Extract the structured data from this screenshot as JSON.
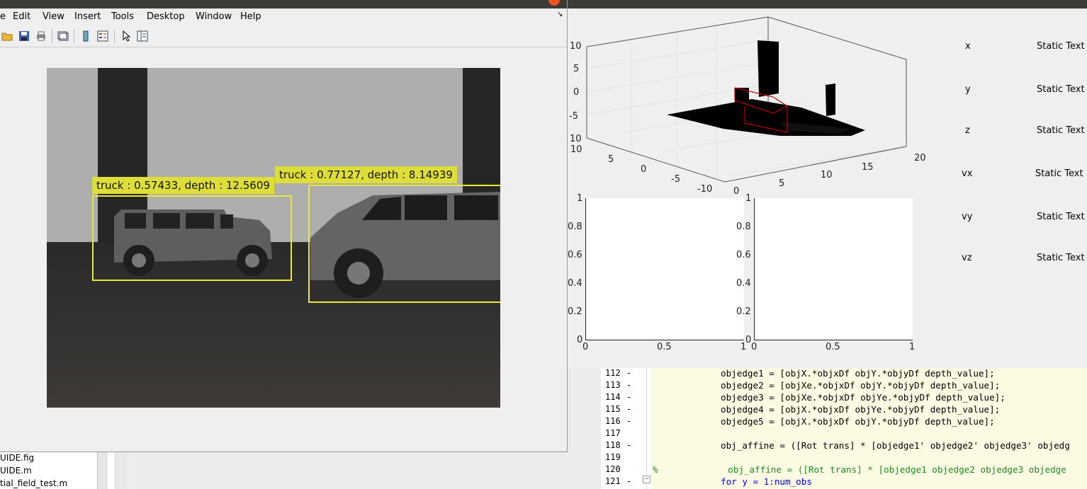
{
  "figure_window": {
    "menu": [
      "e",
      "Edit",
      "View",
      "Insert",
      "Tools",
      "Desktop",
      "Window",
      "Help"
    ],
    "corner_glyph": "↘",
    "detections": [
      {
        "label": "truck : 0.57433, depth : 12.5609"
      },
      {
        "label": "truck : 0.77127, depth : 8.14939"
      }
    ]
  },
  "file_list": [
    "UIDE.fig",
    "UIDE.m",
    "tial_field_test.m"
  ],
  "readouts": [
    {
      "label": "x",
      "value": "Static Text"
    },
    {
      "label": "y",
      "value": "Static Text"
    },
    {
      "label": "z",
      "value": "Static Text"
    },
    {
      "label": "vx",
      "value": "Static Text"
    },
    {
      "label": "vy",
      "value": "Static Text"
    },
    {
      "label": "vz",
      "value": "Static Text"
    }
  ],
  "plot3d": {
    "z_ticks": [
      "10",
      "5",
      "0",
      "-5",
      "10"
    ],
    "y_ticks": [
      "10",
      "5",
      "0",
      "-5",
      "-10"
    ],
    "x_ticks": [
      "0",
      "5",
      "10",
      "15",
      "20"
    ]
  },
  "plot_left": {
    "y_ticks": [
      "1",
      "0.8",
      "0.6",
      "0.4",
      "0.2",
      "0"
    ],
    "x_ticks": [
      "0",
      "0.5",
      "1"
    ]
  },
  "plot_right": {
    "y_ticks": [
      "1",
      "0.8",
      "0.6",
      "0.4",
      "0.2",
      "0"
    ],
    "x_ticks": [
      "0",
      "0.5",
      "1"
    ]
  },
  "editor": {
    "lines": [
      {
        "num": "112",
        "dash": "-",
        "text": "objedge1 = [objX.*objxDf objY.*objyDf depth_value];",
        "kind": "code"
      },
      {
        "num": "113",
        "dash": "-",
        "text": "objedge2 = [objXe.*objxDf objY.*objyDf depth_value];",
        "kind": "code"
      },
      {
        "num": "114",
        "dash": "-",
        "text": "objedge3 = [objXe.*objxDf objYe.*objyDf depth_value];",
        "kind": "code"
      },
      {
        "num": "115",
        "dash": "-",
        "text": "objedge4 = [objX.*objxDf objYe.*objyDf depth_value];",
        "kind": "code"
      },
      {
        "num": "116",
        "dash": "-",
        "text": "objedge5 = [objX.*objxDf objY.*objyDf depth_value];",
        "kind": "code"
      },
      {
        "num": "117",
        "dash": "",
        "text": "",
        "kind": "code"
      },
      {
        "num": "118",
        "dash": "-",
        "text": "obj_affine = ([Rot trans] * [objedge1' objedge2' objedge3' objedg",
        "kind": "code"
      },
      {
        "num": "119",
        "dash": "",
        "text": "",
        "kind": "code"
      },
      {
        "num": "120",
        "dash": "",
        "text": "%             obj_affine = ([Rot trans] * [objedge1 objedge2 objedge3 objedge",
        "kind": "comment"
      },
      {
        "num": "121",
        "dash": "-",
        "text": "for y = 1:num_obs",
        "kind": "kw"
      }
    ]
  }
}
